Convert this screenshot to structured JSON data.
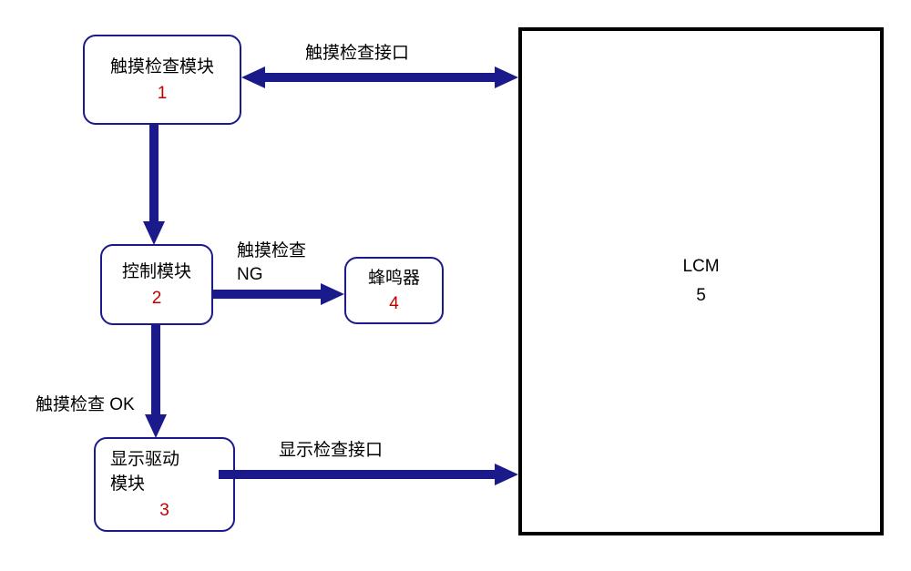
{
  "boxes": {
    "touch_check": {
      "title": "触摸检查模块",
      "number": "1"
    },
    "control": {
      "title": "控制模块",
      "number": "2"
    },
    "buzzer": {
      "title": "蜂鸣器",
      "number": "4"
    },
    "display_driver": {
      "title_line1": "显示驱动",
      "title_line2": "模块",
      "number": "3"
    },
    "lcm": {
      "title": "LCM",
      "number": "5"
    }
  },
  "edges": {
    "touch_to_lcm": "触摸检查接口",
    "control_to_buzzer_line1": "触摸检查",
    "control_to_buzzer_line2": "NG",
    "control_to_display": "触摸检查 OK",
    "display_to_lcm": "显示检查接口"
  }
}
